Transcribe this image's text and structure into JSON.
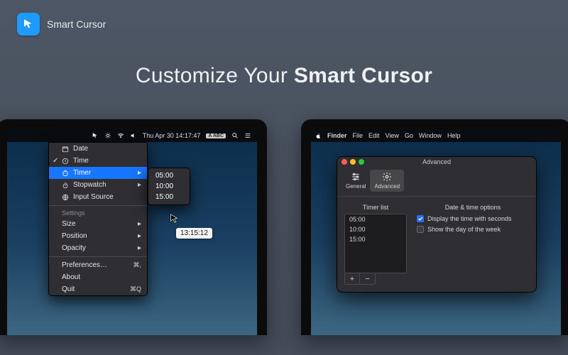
{
  "header": {
    "app_name": "Smart Cursor"
  },
  "headline": {
    "prefix": "Customize Your ",
    "bold": "Smart Cursor"
  },
  "left_screen": {
    "menubar": {
      "datetime": "Thu Apr 30  14:17:47",
      "input_badge": "ABC"
    },
    "dropdown": {
      "items": [
        {
          "icon": "calendar",
          "label": "Date"
        },
        {
          "icon": "clock",
          "label": "Time",
          "checked": true
        },
        {
          "icon": "timer",
          "label": "Timer",
          "highlight": true,
          "chevron": true
        },
        {
          "icon": "stopwatch",
          "label": "Stopwatch",
          "chevron": true
        },
        {
          "icon": "globe",
          "label": "Input Source"
        }
      ],
      "settings_label": "Settings",
      "settings": [
        {
          "label": "Size",
          "chevron": true
        },
        {
          "label": "Position",
          "chevron": true
        },
        {
          "label": "Opacity",
          "chevron": true
        }
      ],
      "footer": [
        {
          "label": "Preferences…",
          "shortcut": "⌘,"
        },
        {
          "label": "About"
        },
        {
          "label": "Quit",
          "shortcut": "⌘Q"
        }
      ]
    },
    "submenu": {
      "items": [
        "05:00",
        "10:00",
        "15:00"
      ]
    },
    "cursor_tag": "13:15:12"
  },
  "right_screen": {
    "menubar": {
      "items": [
        "Finder",
        "File",
        "Edit",
        "View",
        "Go",
        "Window",
        "Help"
      ]
    },
    "prefwin": {
      "title": "Advanced",
      "toolbar": {
        "general": "General",
        "advanced": "Advanced"
      },
      "timer_list_label": "Timer list",
      "timer_list": [
        "05:00",
        "10:00",
        "15:00"
      ],
      "options_label": "Date & time options",
      "options": [
        {
          "label": "Display the time with seconds",
          "checked": true
        },
        {
          "label": "Show the day of the week",
          "checked": false
        }
      ]
    }
  }
}
